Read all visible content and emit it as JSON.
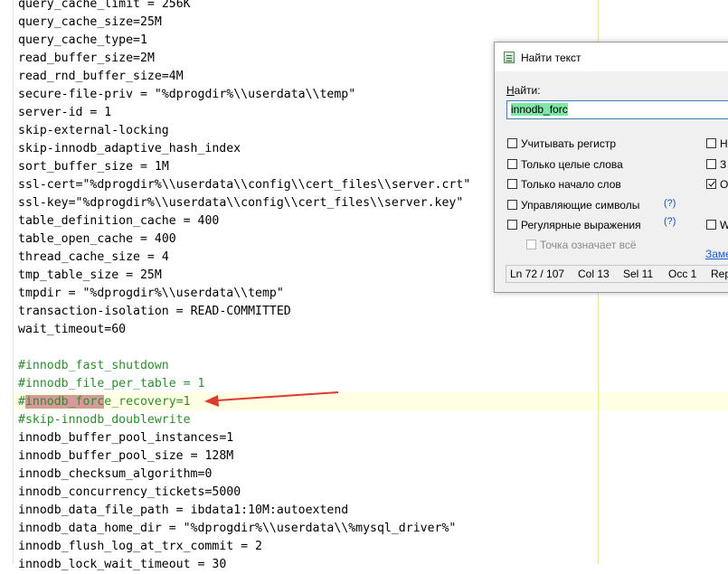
{
  "editor": {
    "lines": [
      {
        "key": "query_cache_limit",
        "op": " = ",
        "val": "256K"
      },
      {
        "key": "query_cache_size",
        "op": "=",
        "val": "25M"
      },
      {
        "key": "query_cache_type",
        "op": "=",
        "val": "1"
      },
      {
        "key": "read_buffer_size",
        "op": "=",
        "val": "2M"
      },
      {
        "key": "read_rnd_buffer_size",
        "op": "=",
        "val": "4M"
      },
      {
        "key": "secure-file-priv",
        "op": " = ",
        "val": "\"%dprogdir%\\\\userdata\\\\temp\""
      },
      {
        "key": "server-id",
        "op": " = ",
        "val": "1"
      },
      {
        "key": "skip-external-locking",
        "op": "",
        "val": ""
      },
      {
        "key": "skip-innodb_adaptive_hash_index",
        "op": "",
        "val": ""
      },
      {
        "key": "sort_buffer_size",
        "op": " = ",
        "val": "1M"
      },
      {
        "key": "ssl-cert",
        "op": "=",
        "val": "\"%dprogdir%\\\\userdata\\\\config\\\\cert_files\\\\server.crt\""
      },
      {
        "key": "ssl-key",
        "op": "=",
        "val": "\"%dprogdir%\\\\userdata\\\\config\\\\cert_files\\\\server.key\""
      },
      {
        "key": "table_definition_cache",
        "op": " = ",
        "val": "400"
      },
      {
        "key": "table_open_cache",
        "op": " = ",
        "val": "400"
      },
      {
        "key": "thread_cache_size",
        "op": " = ",
        "val": "4"
      },
      {
        "key": "tmp_table_size",
        "op": " = ",
        "val": "25M"
      },
      {
        "key": "tmpdir",
        "op": " = ",
        "val": "\"%dprogdir%\\\\userdata\\\\temp\""
      },
      {
        "key": "transaction-isolation",
        "op": " = ",
        "val": "READ-COMMITTED"
      },
      {
        "key": "wait_timeout",
        "op": "=",
        "val": "60"
      },
      {
        "key": "",
        "op": "",
        "val": ""
      },
      {
        "comment": "#innodb_fast_shutdown"
      },
      {
        "comment": "#innodb_file_per_table = 1"
      },
      {
        "comment": "#innodb_force_recovery=1",
        "highlight": "innodb_forc"
      },
      {
        "comment": "#skip-innodb_doublewrite"
      },
      {
        "key": "innodb_buffer_pool_instances",
        "op": "=",
        "val": "1"
      },
      {
        "key": "innodb_buffer_pool_size",
        "op": " = ",
        "val": "128M"
      },
      {
        "key": "innodb_checksum_algorithm",
        "op": "=",
        "val": "0"
      },
      {
        "key": "innodb_concurrency_tickets",
        "op": "=",
        "val": "5000"
      },
      {
        "key": "innodb_data_file_path",
        "op": " = ",
        "val": "ibdata1:10M:autoextend"
      },
      {
        "key": "innodb_data_home_dir",
        "op": " = ",
        "val": "\"%dprogdir%\\\\userdata\\\\%mysql_driver%\""
      },
      {
        "key": "innodb_flush_log_at_trx_commit",
        "op": " = ",
        "val": "2"
      },
      {
        "key": "innodb_lock_wait_timeout",
        "op": " = ",
        "val": "30"
      }
    ],
    "current_line_index": 22,
    "colors": {
      "comment": "#2e8b2e",
      "match_highlight": "#d69a9a",
      "current_line": "#ffffe4",
      "arrow": "#e0392f"
    }
  },
  "find_dialog": {
    "title": "Найти текст",
    "find_label": "Найти:",
    "find_value": "innodb_forc",
    "options_left": [
      {
        "label": "Учитывать регистр",
        "checked": false,
        "disabled": false
      },
      {
        "label": "Только целые слова",
        "checked": false,
        "disabled": false
      },
      {
        "label": "Только начало слов",
        "checked": false,
        "disabled": false
      },
      {
        "label": "Управляющие символы",
        "checked": false,
        "disabled": false
      },
      {
        "label": "Регулярные выражения",
        "checked": false,
        "disabled": false
      },
      {
        "label": "Точка означает всё",
        "checked": false,
        "disabled": true
      }
    ],
    "options_right": [
      {
        "label": "Н",
        "checked": false
      },
      {
        "label": "З",
        "checked": false
      },
      {
        "label": "О",
        "checked": true
      },
      {
        "label": "W",
        "checked": false
      }
    ],
    "help_label": "(?)",
    "replace_link": "Заме",
    "status": {
      "ln": "Ln  72 / 107",
      "col": "Col  13",
      "sel": "Sel  11",
      "occ": "Occ  1",
      "rep": "Rep"
    }
  }
}
